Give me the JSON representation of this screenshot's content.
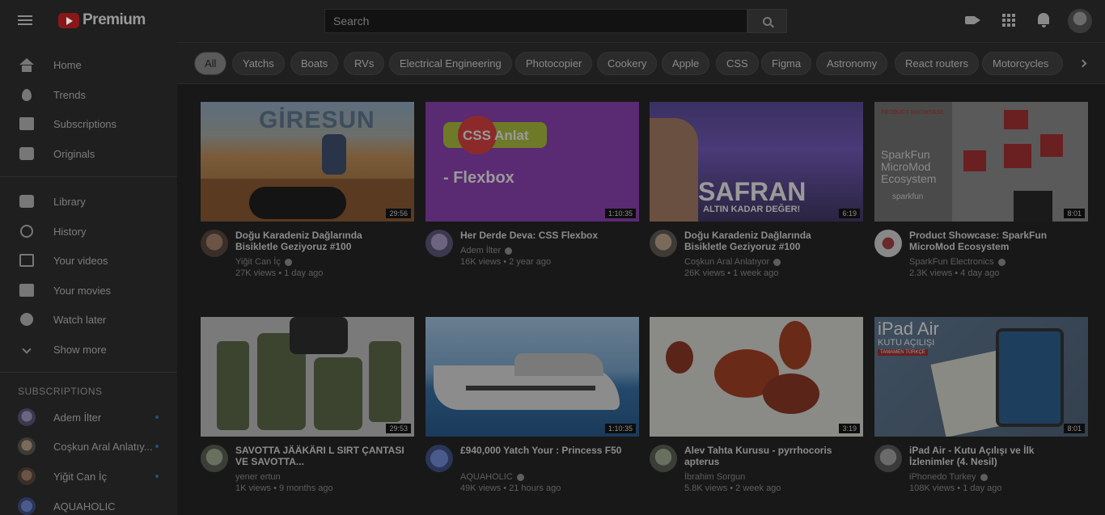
{
  "header": {
    "logo_text": "Premium",
    "search_placeholder": "Search"
  },
  "icons": {
    "menu": "hamburger-menu-icon",
    "search": "search-icon",
    "create": "video-camera-icon",
    "apps": "apps-grid-icon",
    "notifications": "bell-icon"
  },
  "sidebar": {
    "main": [
      {
        "label": "Home",
        "icon": "home-icon"
      },
      {
        "label": "Trends",
        "icon": "flame-icon"
      },
      {
        "label": "Subscriptions",
        "icon": "subscriptions-icon"
      },
      {
        "label": "Originals",
        "icon": "originals-icon"
      }
    ],
    "library": [
      {
        "label": "Library",
        "icon": "library-icon"
      },
      {
        "label": "History",
        "icon": "history-icon"
      },
      {
        "label": "Your videos",
        "icon": "your-videos-icon"
      },
      {
        "label": "Your movies",
        "icon": "movies-icon"
      },
      {
        "label": "Watch later",
        "icon": "clock-icon"
      },
      {
        "label": "Show more",
        "icon": "chevron-down-icon"
      }
    ],
    "subscriptions_heading": "SUBSCRIPTIONS",
    "subscriptions": [
      {
        "label": "Adem İlter"
      },
      {
        "label": "Coşkun Aral Anlatıy..."
      },
      {
        "label": "Yiğit Can İç"
      },
      {
        "label": "AQUAHOLIC"
      }
    ]
  },
  "chips": [
    "All",
    "Yatchs",
    "Boats",
    "RVs",
    "Electrical Engineering",
    "Photocopier",
    "Cookery",
    "Apple",
    "CSS",
    "Figma",
    "Astronomy",
    "React routers",
    "Motorcycles"
  ],
  "videos": [
    {
      "title": "Doğu Karadeniz Dağlarında Bisikletle Geziyoruz #100",
      "channel": "Yiğit Can İç",
      "meta": "27K views • 1 day ago",
      "duration": "29:56",
      "thumb_text": "GİRESUN"
    },
    {
      "title": "Her Derde Deva: CSS Flexbox",
      "channel": "Adem İlter",
      "meta": "16K views • 2 year ago",
      "duration": "1:10:35",
      "thumb_text": "- Flexbox",
      "thumb_badge": "CSS Anlat"
    },
    {
      "title": "Doğu Karadeniz Dağlarında Bisikletle Geziyoruz #100",
      "channel": "Coşkun Aral Anlatıyor",
      "meta": "26K views • 1 week ago",
      "duration": "6:19",
      "thumb_text": "SAFRAN",
      "thumb_sub": "ALTIN KADAR DEĞER!"
    },
    {
      "title": "Product Showcase: SparkFun MicroMod Ecosystem",
      "channel": "SparkFun Electronics",
      "meta": "2.3K views • 4 day ago",
      "duration": "8:01",
      "thumb_text": "SparkFun MicroMod Ecosystem",
      "thumb_badge": "sparkfun",
      "thumb_top": "PRODUCT SHOWCASE"
    },
    {
      "title": "SAVOTTA JÄÄKÄRI L SIRT ÇANTASI VE SAVOTTA...",
      "channel": "yener ertun",
      "meta": "1K views • 9 months ago",
      "duration": "29:53"
    },
    {
      "title": "£940,000 Yatch Your : Princess F50",
      "channel": "AQUAHOLIC",
      "meta": "49K views • 21 hours ago",
      "duration": "1:10:35"
    },
    {
      "title": "Alev Tahta Kurusu - pyrrhocoris apterus",
      "channel": "İbrahim Sorgun",
      "meta": "5.8K views • 2 week ago",
      "duration": "3:19"
    },
    {
      "title": "iPad Air - Kutu Açılışı ve İlk İzlenimler (4. Nesil)",
      "channel": "iPhonedo Turkey",
      "meta": "108K views • 1 day ago",
      "duration": "8:01",
      "thumb_text": "iPad Air",
      "thumb_sub": "KUTU AÇILIŞI",
      "thumb_badge": "TAMAMEN TÜRKÇE"
    }
  ]
}
